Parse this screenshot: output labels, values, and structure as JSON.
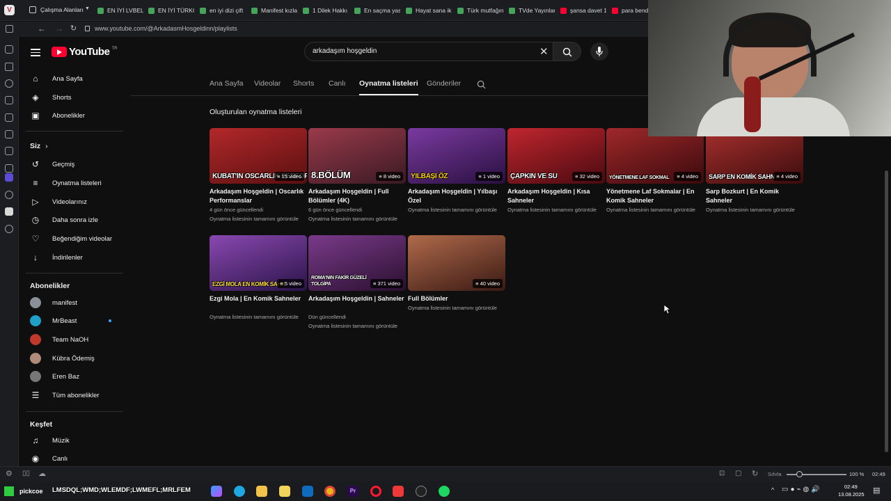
{
  "browser": {
    "workspaces_label": "Çalışma Alanları",
    "tabs": [
      "EN İYİ LVBEL C",
      "EN İYİ TÜRKÇ",
      "en iyi dizi çift",
      "Manifest kızla",
      "1 Dilek Hakkı",
      "En saçma yas",
      "Hayat sana ik",
      "Türk mutfağın",
      "TVde Yayınlan",
      "şansa davet 1",
      "para bende"
    ],
    "url": "www.youtube.com/@ArkadasmHosgeldinn/playlists"
  },
  "youtube": {
    "logo_text": "YouTube",
    "logo_suffix": "TR",
    "search_value": "arkadaşım hoşgeldin"
  },
  "sidebar": {
    "main": [
      {
        "label": "Ana Sayfa",
        "icon": "home-icon"
      },
      {
        "label": "Shorts",
        "icon": "shorts-icon"
      },
      {
        "label": "Abonelikler",
        "icon": "subscriptions-icon"
      }
    ],
    "you_header": "Siz",
    "you": [
      {
        "label": "Geçmiş",
        "icon": "history-icon"
      },
      {
        "label": "Oynatma listeleri",
        "icon": "playlists-icon"
      },
      {
        "label": "Videolarınız",
        "icon": "your-videos-icon"
      },
      {
        "label": "Daha sonra izle",
        "icon": "watch-later-icon"
      },
      {
        "label": "Beğendiğim videolar",
        "icon": "liked-icon"
      },
      {
        "label": "İndirilenler",
        "icon": "download-icon"
      }
    ],
    "subs_header": "Abonelikler",
    "subscriptions": [
      {
        "label": "manifest",
        "color": "#8a8f98"
      },
      {
        "label": "MrBeast",
        "color": "#1fa0c8"
      },
      {
        "label": "Team NaOH",
        "color": "#c0392b"
      },
      {
        "label": "Kübra Ödemiş",
        "color": "#b08a7a"
      },
      {
        "label": "Eren Baz",
        "color": "#777777"
      }
    ],
    "all_subs": "Tüm abonelikler",
    "explore_header": "Keşfet",
    "explore": [
      {
        "label": "Müzik",
        "icon": "music-icon"
      },
      {
        "label": "Canlı",
        "icon": "live-icon"
      }
    ]
  },
  "channel_tabs": [
    "Ana Sayfa",
    "Videolar",
    "Shorts",
    "Canlı",
    "Oynatma listeleri",
    "Gönderiler"
  ],
  "active_tab": "Oynatma listeleri",
  "section_title": "Oluşturulan oynatma listeleri",
  "playlists": [
    {
      "title": "Arkadaşım Hoşgeldin | Oscarlık Performanslar",
      "count": "15 video",
      "meta1": "4 gün önce güncellendi",
      "meta2": "Oynatma listesinin tamamını görüntüle",
      "caption": "KUBAT'IN OSCARLIK PERFORMANSI",
      "bg": "#8c1a1a"
    },
    {
      "title": "Arkadaşım Hoşgeldin | Full Bölümler (4K)",
      "count": "8 video",
      "meta1": "6 gün önce güncellendi",
      "meta2": "Oynatma listesinin tamamını görüntüle",
      "caption": "8.BÖLÜM",
      "bg": "#6b2a3a"
    },
    {
      "title": "Arkadaşım Hoşgeldin | Yılbaşı Özel",
      "count": "1 video",
      "meta1": "Oynatma listesinin tamamını görüntüle",
      "meta2": "",
      "caption": "YILBAŞI ÖZ",
      "bg": "#5a2a7a"
    },
    {
      "title": "Arkadaşım Hoşgeldin | Kısa Sahneler",
      "count": "32 video",
      "meta1": "Oynatma listesinin tamamını görüntüle",
      "meta2": "",
      "caption": "ÇAPKIN VE SU",
      "bg": "#9a1c24"
    },
    {
      "title": "Yönetmene Laf Sokmalar | En Komik Sahneler",
      "count": "4 video",
      "meta1": "Oynatma listesinin tamamını görüntüle",
      "meta2": "",
      "caption": "YÖNETMENE LAF SOKMAL",
      "bg": "#7a1a1a"
    },
    {
      "title": "Sarp Bozkurt | En Komik Sahneler",
      "count": "4 video",
      "meta1": "Oynatma listesinin tamamını görüntüle",
      "meta2": "",
      "caption": "SARP EN KOMİK SAHN",
      "bg": "#862020"
    },
    {
      "title": "Ezgi Mola | En Komik Sahneler",
      "count": "5 video",
      "meta1": "Oynatma listesinin tamamını görüntüle",
      "meta2": "",
      "caption": "EZGİ MOLA EN KOMİK SAHN",
      "bg": "#7a3a8a"
    },
    {
      "title": "Arkadaşım Hoşgeldin | Sahneler",
      "count": "371 video",
      "meta1": "Dün güncellendi",
      "meta2": "Oynatma listesinin tamamını görüntüle",
      "caption": "ROMA'NIN FAKİR GÜZELİ TOLGİPA",
      "bg": "#5a2a6a"
    },
    {
      "title": "Full Bölümler",
      "count": "40 video",
      "meta1": "Oynatma listesinin tamamını görüntüle",
      "meta2": "",
      "caption": "",
      "bg": "#8a4a3a"
    }
  ],
  "statusbar": {
    "zoom_label": "Sıfırla",
    "zoom": "100 %",
    "time": "02:49"
  },
  "taskbar": {
    "search_text": "LMSDQL;WMD;WLEMDF;LWMEFL;MRLFEM",
    "app_name": "pickcoe",
    "time": "02:49",
    "date": "13.08.2025"
  }
}
